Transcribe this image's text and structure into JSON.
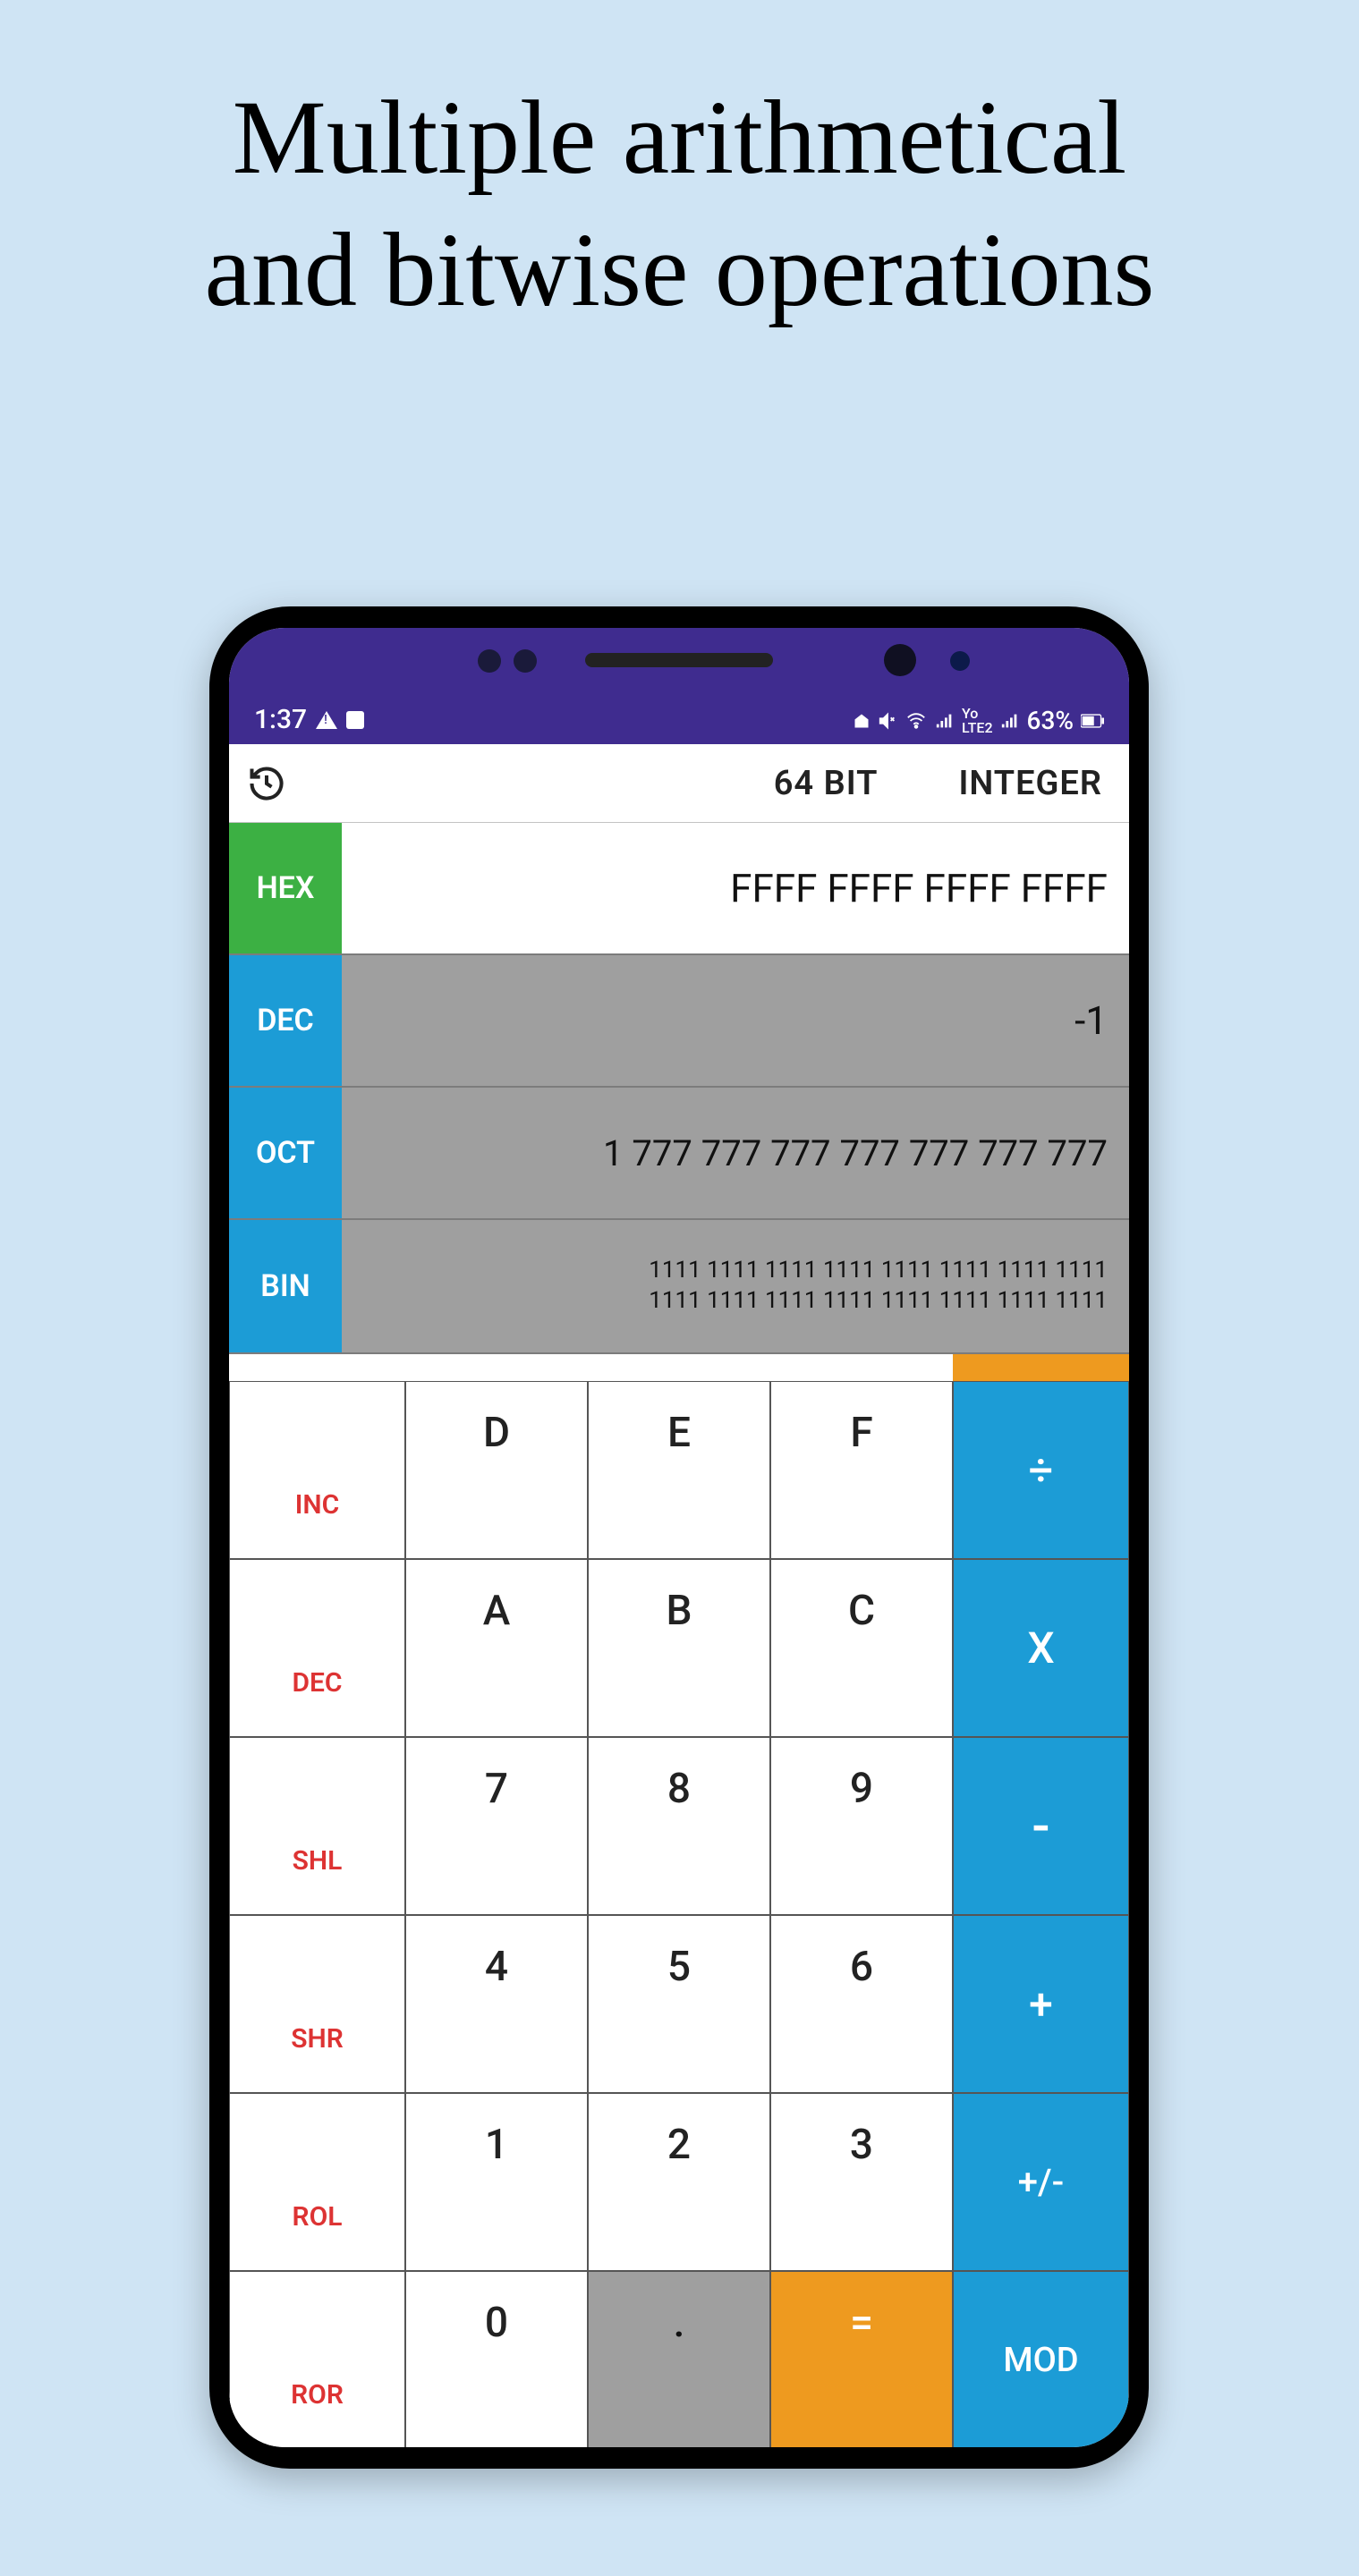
{
  "promo": {
    "title": "Multiple arithmetical\nand bitwise operations"
  },
  "statusbar": {
    "time": "1:37",
    "battery": "63%"
  },
  "header": {
    "bit_mode": "64 BIT",
    "type_mode": "INTEGER"
  },
  "bases": {
    "hex": {
      "label": "HEX",
      "value": "FFFF FFFF FFFF FFFF"
    },
    "dec": {
      "label": "DEC",
      "value": "-1"
    },
    "oct": {
      "label": "OCT",
      "value": "1 777 777 777 777 777 777 777"
    },
    "bin": {
      "label": "BIN",
      "value": "1111 1111 1111 1111 1111 1111 1111 1111\n1111 1111 1111 1111 1111 1111 1111 1111"
    }
  },
  "keys": {
    "unary": [
      "INC",
      "DEC",
      "SHL",
      "SHR",
      "ROL",
      "ROR"
    ],
    "nums": {
      "r0": [
        "D",
        "E",
        "F"
      ],
      "r1": [
        "A",
        "B",
        "C"
      ],
      "r2": [
        "7",
        "8",
        "9"
      ],
      "r3": [
        "4",
        "5",
        "6"
      ],
      "r4": [
        "1",
        "2",
        "3"
      ],
      "r5": [
        "0",
        ".",
        "="
      ]
    },
    "ops": [
      "÷",
      "X",
      "-",
      "+",
      "+/-",
      "MOD"
    ]
  }
}
